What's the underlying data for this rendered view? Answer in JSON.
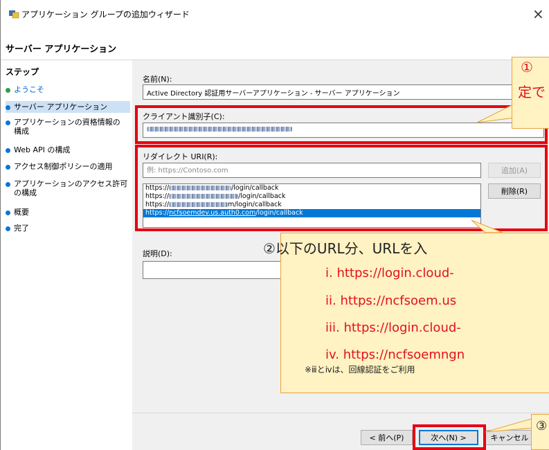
{
  "window": {
    "title": "アプリケーション グループの追加ウィザード",
    "close_label": "×"
  },
  "header": {
    "title": "サーバー アプリケーション"
  },
  "steps": {
    "title": "ステップ",
    "items": [
      {
        "label": "ようこそ"
      },
      {
        "label": "サーバー アプリケーション"
      },
      {
        "label": "アプリケーションの資格情報の",
        "label2": "構成"
      },
      {
        "label": "Web API の構成"
      },
      {
        "label": "アクセス制御ポリシーの適用"
      },
      {
        "label": "アプリケーションのアクセス許可",
        "label2": "の構成"
      },
      {
        "label": "概要"
      },
      {
        "label": "完了"
      }
    ]
  },
  "colors": {
    "step_done": "#2ea043",
    "step_current": "#0e74d8",
    "highlight_red": "#e60012",
    "callout_bg": "#fff2c3"
  },
  "form": {
    "name_label": "名前(N):",
    "name_value": "Active Directory 認証用サーバーアプリケーション - サーバー アプリケーション",
    "client_id_label": "クライアント識別子(C):",
    "redirect_label": "リダイレクト URI(R):",
    "redirect_placeholder": "例: https://Contoso.com",
    "add_button": "追加(A)",
    "delete_button": "削除(R)",
    "uri_list": [
      {
        "prefix": "https://",
        "suffix": "/login/callback"
      },
      {
        "prefix": "https://",
        "suffix": "/login/callback"
      },
      {
        "prefix": "https://",
        "suffix": "m/login/callback"
      },
      {
        "prefix": "https://",
        "suffix": "/login/callback",
        "middle": "ncfsoemdev.us.auth0.com"
      }
    ],
    "description_label": "説明(D):"
  },
  "footer": {
    "prev_button": "< 前へ(P)",
    "next_button": "次へ(N) >",
    "cancel_button": "キャンセル"
  },
  "callouts": {
    "c1_line1": "①",
    "c1_line2": "定で",
    "c2_title": "②以下のURL分、URLを入",
    "c2_items": [
      "i.    https://login.cloud-",
      "ii.   https://ncfsoem.us",
      "iii.  https://login.cloud-",
      "iv.  https://ncfsoemngn"
    ],
    "c2_note": "※ⅲとⅳは、回線認証をご利用",
    "c3_text": "③"
  }
}
